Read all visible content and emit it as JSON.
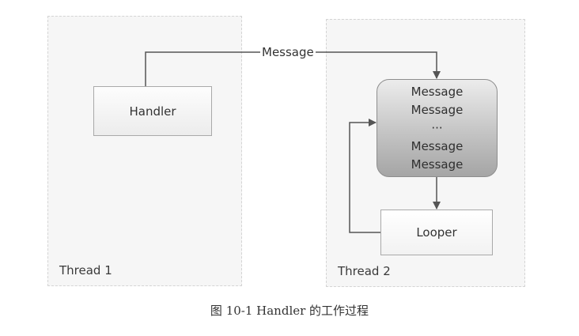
{
  "diagram": {
    "threads": [
      {
        "label": "Thread 1"
      },
      {
        "label": "Thread 2"
      }
    ],
    "handler_label": "Handler",
    "looper_label": "Looper",
    "message_label": "Message",
    "queue_items": [
      "Message",
      "Message",
      "···",
      "Message",
      "Message"
    ],
    "line_color": "#555555"
  },
  "caption": "图 10-1   Handler 的工作过程"
}
